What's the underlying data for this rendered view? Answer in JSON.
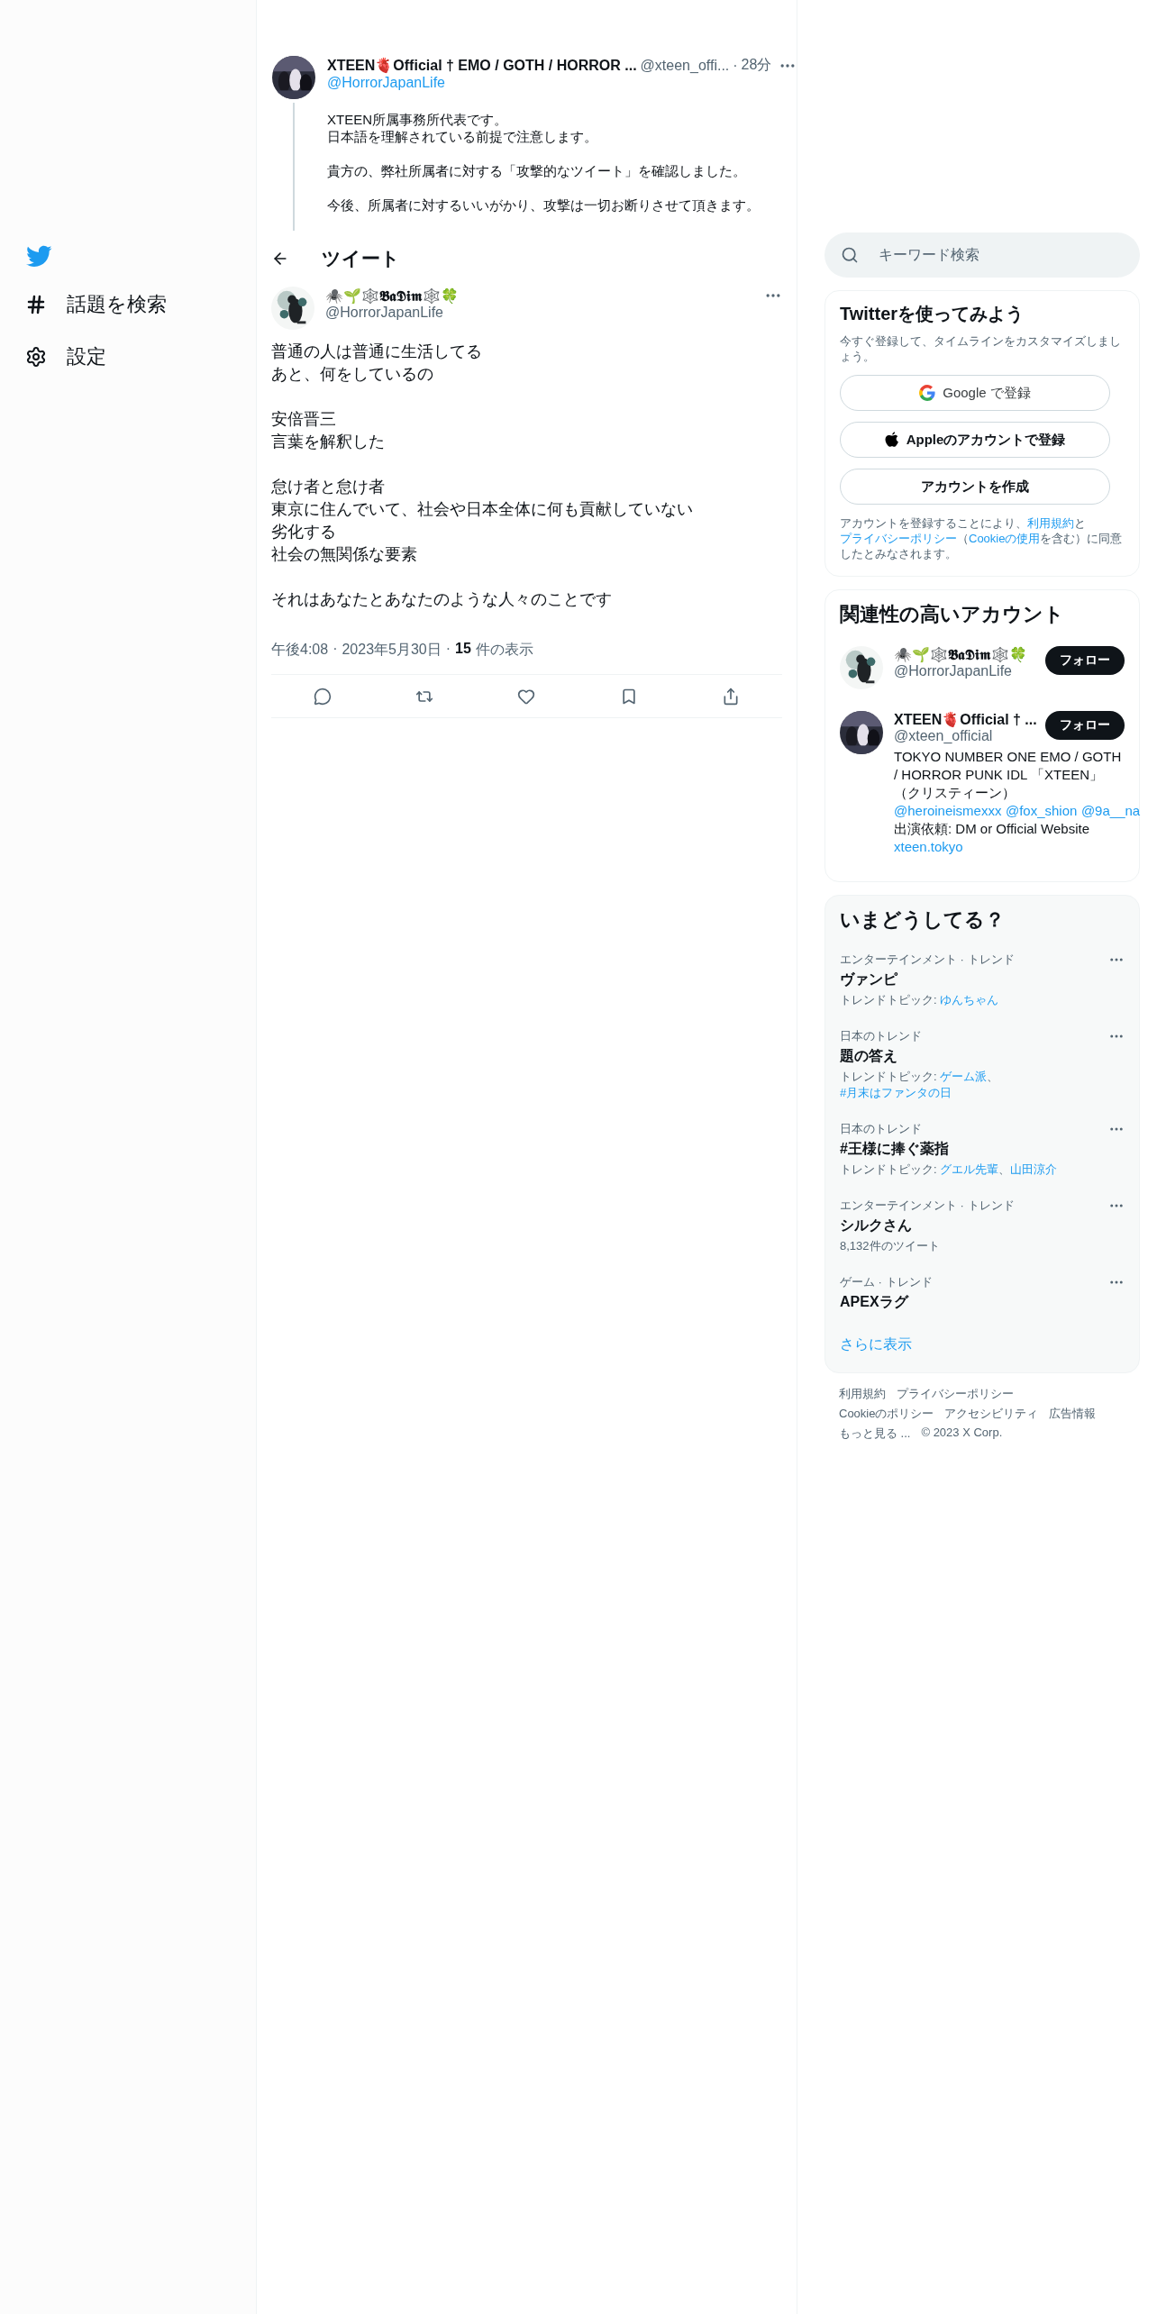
{
  "sidebar": {
    "items": [
      {
        "kind": "hash",
        "label": "話題を検索"
      },
      {
        "kind": "gear",
        "label": "設定"
      }
    ]
  },
  "parent_tweet": {
    "name": "XTEEN🫀Official † EMO / GOTH / HORROR ...",
    "handle": "@xteen_offi...",
    "separator": "·",
    "time": "28分",
    "reply_to": "@HorrorJapanLife",
    "paragraphs": [
      [
        "XTEEN所属事務所代表です。",
        "日本語を理解されている前提で注意します。"
      ],
      [
        "貴方の、弊社所属者に対する「攻撃的なツイート」を確認しました。"
      ],
      [
        "今後、所属者に対するいいがかり、攻撃は一切お断りさせて頂きます。"
      ]
    ]
  },
  "header": {
    "title": "ツイート"
  },
  "tweet": {
    "name": "🕷️🌱🕸️𝕭𝖆𝕯𝖎𝖒🕸️🍀",
    "handle": "@HorrorJapanLife",
    "paragraphs": [
      [
        "普通の人は普通に生活してる",
        "あと、何をしているの"
      ],
      [
        "安倍晋三",
        "言葉を解釈した"
      ],
      [
        "怠け者と怠け者",
        "東京に住んでいて、社会や日本全体に何も貢献していない",
        "劣化する",
        "社会の無関係な要素"
      ],
      [
        "それはあなたとあなたのような人々のことです"
      ]
    ],
    "time": "午後4:08",
    "separator_1": "·",
    "date": "2023年5月30日",
    "separator_2": "·",
    "views_count": "15",
    "views_label": "件の表示",
    "actions": [
      {
        "kind": "reply"
      },
      {
        "kind": "retweet"
      },
      {
        "kind": "like"
      },
      {
        "kind": "bookmark"
      },
      {
        "kind": "share"
      }
    ]
  },
  "search": {
    "placeholder": "キーワード検索"
  },
  "signup": {
    "title": "Twitterを使ってみよう",
    "subtitle": "今すぐ登録して、タイムラインをカスタマイズしましょう。",
    "buttons": [
      {
        "kind": "google",
        "label": "Google で登録"
      },
      {
        "kind": "apple",
        "label": "Appleのアカウントで登録"
      },
      {
        "kind": "plain",
        "label": "アカウントを作成"
      }
    ],
    "legal": [
      {
        "text": "アカウントを登録することにより、",
        "link": false
      },
      {
        "text": "利用規約",
        "link": true
      },
      {
        "text": "と",
        "link": false
      },
      {
        "text": "プライバシーポリシー",
        "link": true
      },
      {
        "text": "（",
        "link": false
      },
      {
        "text": "Cookieの使用",
        "link": true
      },
      {
        "text": "を含む）に同意したとみなされます。",
        "link": false
      }
    ]
  },
  "who_to_follow": {
    "title": "関連性の高いアカウント",
    "accounts": [
      {
        "kind": "crow",
        "name": "🕷️🌱🕸️𝕭𝖆𝕯𝖎𝖒🕸️🍀",
        "handle": "@HorrorJapanLife",
        "button": "フォロー"
      },
      {
        "kind": "group",
        "name": "XTEEN🫀Official † ...",
        "handle": "@xteen_official",
        "button": "フォロー",
        "bio": [
          {
            "text": "TOKYO NUMBER ONE EMO / GOTH / HORROR PUNK IDL 「XTEEN」（クリスティーン）",
            "link": false
          },
          {
            "text": "@heroineismexxx",
            "link": true,
            "space_after": true
          },
          {
            "text": "@fox_shion",
            "link": true,
            "space_after": true
          },
          {
            "text": "@9a__na",
            "link": true
          },
          {
            "text": " 出演依頼: DM or Official Website ",
            "link": false
          },
          {
            "text": "xteen.tokyo",
            "link": true
          }
        ]
      }
    ]
  },
  "trends": {
    "title": "いまどうしてる？",
    "items": [
      {
        "category": "エンターテインメント · トレンド",
        "name": "ヴァンピ",
        "topics_label": "トレンドトピック: ",
        "topics": [
          {
            "text": "ゆんちゃん",
            "link": true
          }
        ]
      },
      {
        "category": "日本のトレンド",
        "name": "題の答え",
        "topics_label": "トレンドトピック: ",
        "topics": [
          {
            "text": "ゲーム派",
            "link": true
          },
          {
            "text": "、",
            "link": false
          },
          {
            "text": "#月末はファンタの日",
            "link": true
          }
        ]
      },
      {
        "category": "日本のトレンド",
        "name": "#王様に捧ぐ薬指",
        "topics_label": "トレンドトピック: ",
        "topics": [
          {
            "text": "グエル先輩",
            "link": true
          },
          {
            "text": "、",
            "link": false
          },
          {
            "text": "山田涼介",
            "link": true
          }
        ]
      },
      {
        "category": "エンターテインメント · トレンド",
        "name": "シルクさん",
        "count": "8,132件のツイート"
      },
      {
        "category": "ゲーム · トレンド",
        "name": "APEXラグ"
      }
    ],
    "more": "さらに表示"
  },
  "footer": {
    "rows": [
      [
        "利用規約",
        "プライバシーポリシー"
      ],
      [
        "Cookieのポリシー",
        "アクセシビリティ",
        "広告情報"
      ],
      [
        "もっと見る ...",
        "© 2023 X Corp."
      ]
    ]
  }
}
